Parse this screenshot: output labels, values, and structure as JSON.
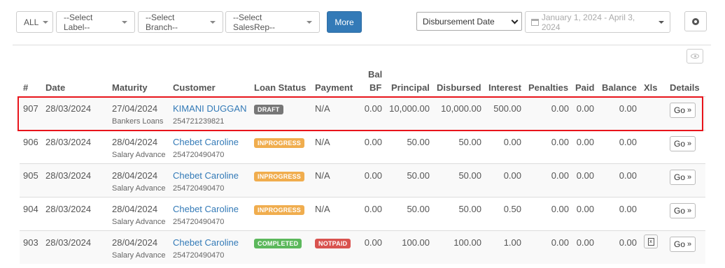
{
  "filters": {
    "all": "ALL",
    "label": "--Select Label--",
    "branch": "--Select Branch--",
    "salesrep": "--Select SalesRep--",
    "more": "More",
    "date_type": "Disbursement Date",
    "date_range": "January 1, 2024 - April 3, 2024"
  },
  "icons": {
    "calendar": "calendar-icon",
    "gear": "gear-icon",
    "eye": "eye-icon",
    "xls": "excel-file-icon",
    "go": "double-chevron-right-icon"
  },
  "columns": {
    "num": "#",
    "date": "Date",
    "maturity": "Maturity",
    "customer": "Customer",
    "loan_status": "Loan Status",
    "payment": "Payment",
    "bal_bf_1": "Bal",
    "bal_bf_2": "BF",
    "principal": "Principal",
    "disbursed": "Disbursed",
    "interest": "Interest",
    "penalties": "Penalties",
    "paid": "Paid",
    "balance": "Balance",
    "xls": "Xls",
    "details": "Details"
  },
  "colors": {
    "draft": "#777777",
    "inprogress": "#f0ad4e",
    "completed": "#5cb85c",
    "notpaid": "#d9534f",
    "link": "#337ab7",
    "highlight": "#e8141b"
  },
  "rows": [
    {
      "id": "907",
      "date": "28/03/2024",
      "maturity": "27/04/2024",
      "product": "Bankers Loans",
      "customer": "KIMANI DUGGAN",
      "phone": "254721239821",
      "status": "DRAFT",
      "payment": "N/A",
      "bal_bf": "0.00",
      "principal": "10,000.00",
      "disbursed": "10,000.00",
      "interest": "500.00",
      "penalties": "0.00",
      "paid": "0.00",
      "balance": "0.00",
      "go": "Go"
    },
    {
      "id": "906",
      "date": "28/03/2024",
      "maturity": "28/04/2024",
      "product": "Salary Advance",
      "customer": "Chebet Caroline",
      "phone": "254720490470",
      "status": "INPROGRESS",
      "payment": "N/A",
      "bal_bf": "0.00",
      "principal": "50.00",
      "disbursed": "50.00",
      "interest": "0.00",
      "penalties": "0.00",
      "paid": "0.00",
      "balance": "0.00",
      "go": "Go"
    },
    {
      "id": "905",
      "date": "28/03/2024",
      "maturity": "28/04/2024",
      "product": "Salary Advance",
      "customer": "Chebet Caroline",
      "phone": "254720490470",
      "status": "INPROGRESS",
      "payment": "N/A",
      "bal_bf": "0.00",
      "principal": "50.00",
      "disbursed": "50.00",
      "interest": "0.00",
      "penalties": "0.00",
      "paid": "0.00",
      "balance": "0.00",
      "go": "Go"
    },
    {
      "id": "904",
      "date": "28/03/2024",
      "maturity": "28/04/2024",
      "product": "Salary Advance",
      "customer": "Chebet Caroline",
      "phone": "254720490470",
      "status": "INPROGRESS",
      "payment": "N/A",
      "bal_bf": "0.00",
      "principal": "50.00",
      "disbursed": "50.00",
      "interest": "0.50",
      "penalties": "0.00",
      "paid": "0.00",
      "balance": "0.00",
      "go": "Go"
    },
    {
      "id": "903",
      "date": "28/03/2024",
      "maturity": "28/04/2024",
      "product": "Salary Advance",
      "customer": "Chebet Caroline",
      "phone": "254720490470",
      "status": "COMPLETED",
      "payment": "NOTPAID",
      "bal_bf": "0.00",
      "principal": "100.00",
      "disbursed": "100.00",
      "interest": "1.00",
      "penalties": "0.00",
      "paid": "0.00",
      "balance": "0.00",
      "go": "Go"
    }
  ]
}
